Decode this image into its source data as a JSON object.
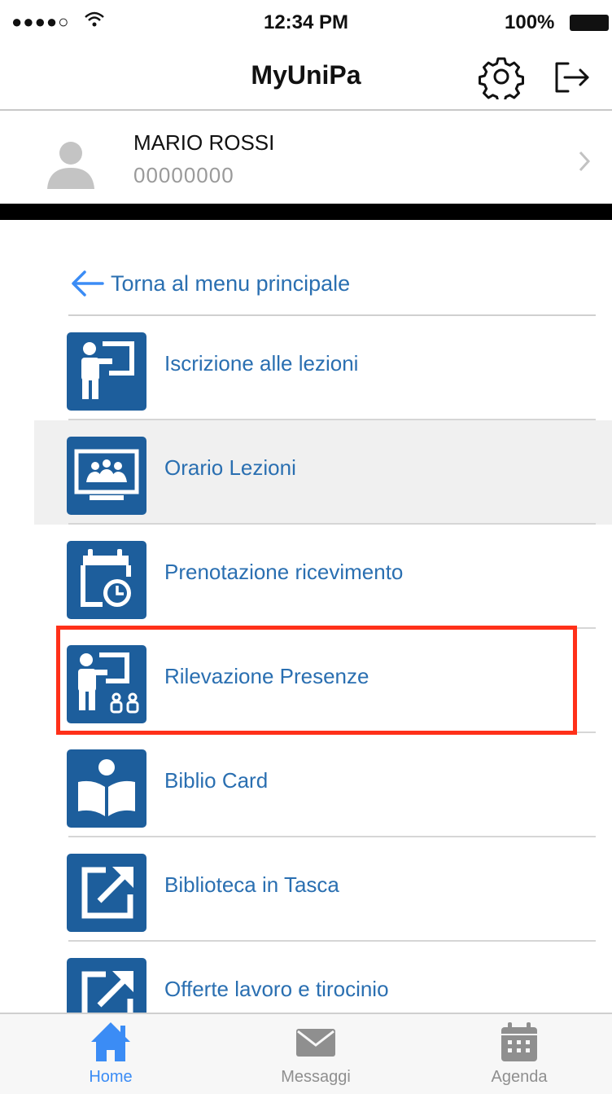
{
  "status_bar": {
    "signal": "●●●●○",
    "time": "12:34 PM",
    "battery": "100%"
  },
  "nav": {
    "title": "MyUniPa",
    "settings_icon": "gear-icon",
    "logout_icon": "logout-icon"
  },
  "profile": {
    "name": "MARIO ROSSI",
    "id": "00000000"
  },
  "back_link": {
    "label": "Torna al menu principale"
  },
  "menu": {
    "items": [
      {
        "label": "Iscrizione alle lezioni",
        "icon": "teacher-board-icon"
      },
      {
        "label": "Orario Lezioni",
        "icon": "classroom-icon"
      },
      {
        "label": "Prenotazione ricevimento",
        "icon": "calendar-clock-icon"
      },
      {
        "label": "Rilevazione Presenze",
        "icon": "attendance-icon"
      },
      {
        "label": "Biblio Card",
        "icon": "book-reader-icon"
      },
      {
        "label": "Biblioteca in Tasca",
        "icon": "external-link-icon"
      },
      {
        "label": "Offerte lavoro e tirocinio",
        "icon": "external-link-icon"
      }
    ],
    "selected_index": 1,
    "highlighted_index": 3
  },
  "tabs": [
    {
      "label": "Home",
      "icon": "home-icon",
      "active": true
    },
    {
      "label": "Messaggi",
      "icon": "envelope-icon",
      "active": false
    },
    {
      "label": "Agenda",
      "icon": "calendar-icon",
      "active": false
    }
  ],
  "colors": {
    "tile_blue": "#1d5e9c",
    "link_blue": "#2a6fb1",
    "highlight_red": "#ff3019",
    "tab_active": "#3b8cf5"
  }
}
